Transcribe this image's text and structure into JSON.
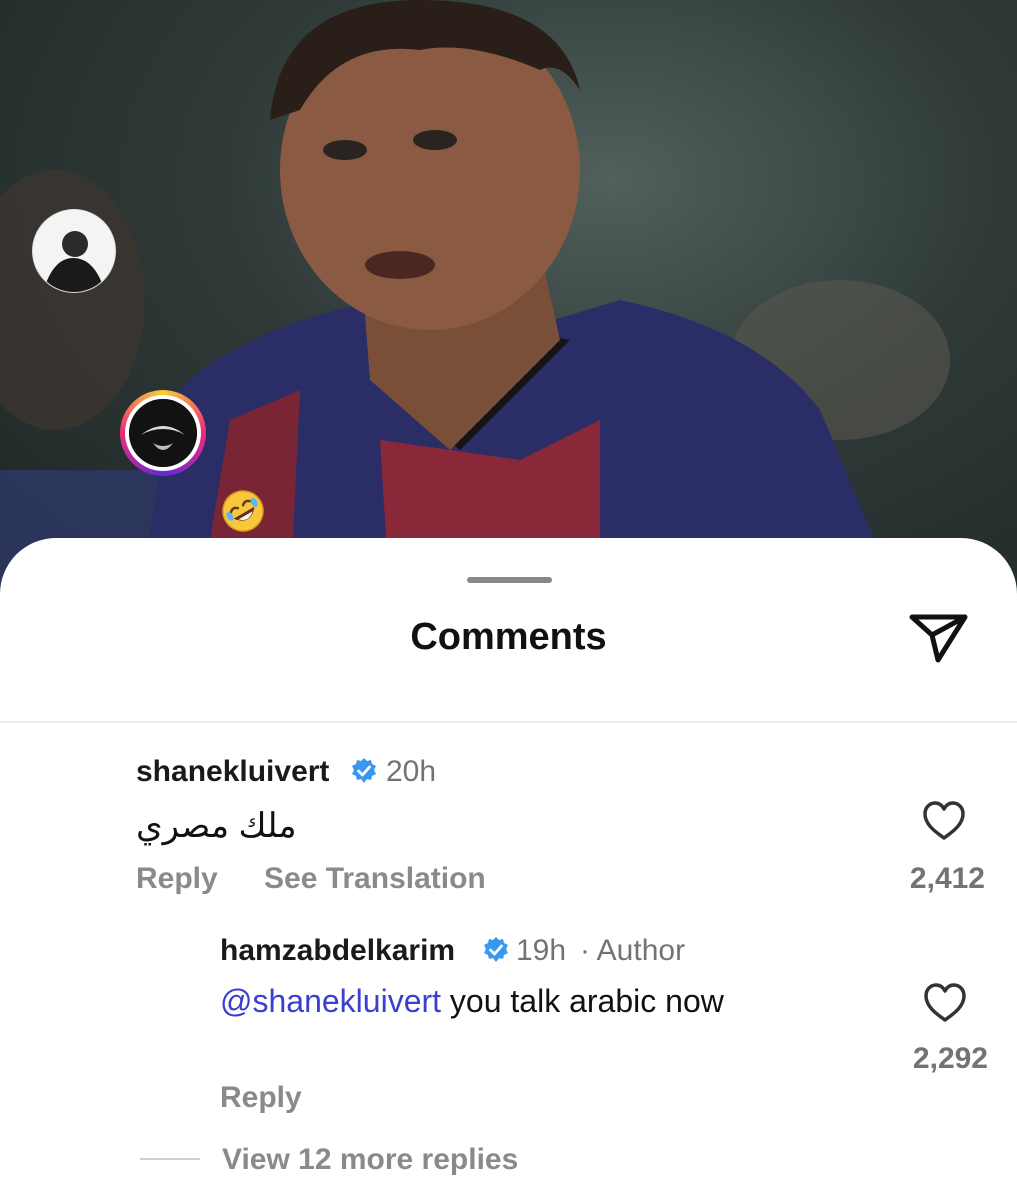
{
  "sheet": {
    "title": "Comments"
  },
  "comments": [
    {
      "username": "shanekluivert",
      "time": "20h",
      "text": "ملك مصري",
      "actions": {
        "reply": "Reply",
        "translate": "See Translation"
      },
      "likes": "2,412"
    }
  ],
  "reply": {
    "username": "hamzabdelkarim",
    "time": "19h",
    "author_label": "· Author",
    "mention": "@shanekluivert",
    "text": "you talk arabic now",
    "reply_action": "Reply",
    "likes": "2,292"
  },
  "more_replies": "View 12 more replies",
  "colors": {
    "mention": "#3a3fd0",
    "verified": "#3897f0"
  },
  "icons": {
    "share": "paper-plane-icon",
    "like": "heart-icon",
    "verified": "verified-badge-icon",
    "emoji": "rolling-laughing-emoji"
  }
}
